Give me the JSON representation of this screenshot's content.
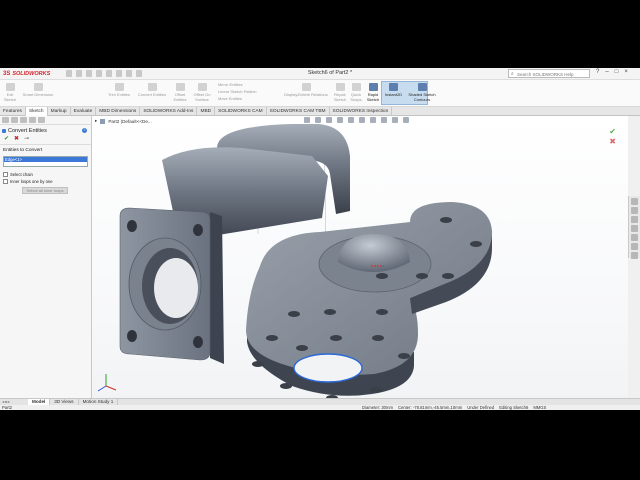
{
  "app": {
    "brand_ds": "3S",
    "brand_name": "SOLIDWORKS",
    "document_title": "Sketch6 of Part2 *",
    "search_placeholder": "Search SOLIDWORKS Help"
  },
  "toolbar": {
    "items": [
      {
        "label": "Exit Sketch",
        "active": false
      },
      {
        "label": "Smart Dimension",
        "active": false
      },
      {
        "label": "Trim Entities",
        "active": false
      },
      {
        "label": "Convert Entities",
        "active": false
      },
      {
        "label": "Offset Entities",
        "active": false
      },
      {
        "label": "Offset On Surface",
        "active": false
      },
      {
        "label": "Mirror Entities",
        "active": false
      },
      {
        "label": "Linear Sketch Pattern",
        "active": false
      },
      {
        "label": "Move Entities",
        "active": false
      },
      {
        "label": "Display/Delete Relations",
        "active": false
      },
      {
        "label": "Repair Sketch",
        "active": false
      },
      {
        "label": "Quick Snaps",
        "active": false
      },
      {
        "label": "Rapid Sketch",
        "active": true
      },
      {
        "label": "Instant2D",
        "active": true
      },
      {
        "label": "Shaded Sketch Contours",
        "active": true
      }
    ]
  },
  "tabs": [
    "Features",
    "Sketch",
    "Markup",
    "Evaluate",
    "MBD Dimensions",
    "SOLIDWORKS Add-Ins",
    "MBD",
    "SOLIDWORKS CAM",
    "SOLIDWORKS CAM TBM",
    "SOLIDWORKS Inspection"
  ],
  "active_tab": "Sketch",
  "property_manager": {
    "title": "Convert Entities",
    "help": "?",
    "ok": "✔",
    "cancel": "✖",
    "pin": "⊸",
    "group_title": "Entities to Convert",
    "selected_item": "Edge<1>",
    "select_chain": "Select chain",
    "inner_loops": "Inner loops one by one",
    "select_all_button": "Select all inner loops"
  },
  "graphics": {
    "tree_label": "Part2  (Default<<De...",
    "confirm_ok": "✔",
    "confirm_cancel": "✖"
  },
  "model_tabs": [
    "Model",
    "3D Views",
    "Motion Study 1"
  ],
  "active_model_tab": "Model",
  "status": {
    "left": "Part2",
    "diameter": "Diameter: 30mm",
    "center": "Center: -78.81mm,-45.5mm,10mm",
    "state": "Under Defined",
    "editing": "Editing Sketch6",
    "units": "MMGS"
  }
}
